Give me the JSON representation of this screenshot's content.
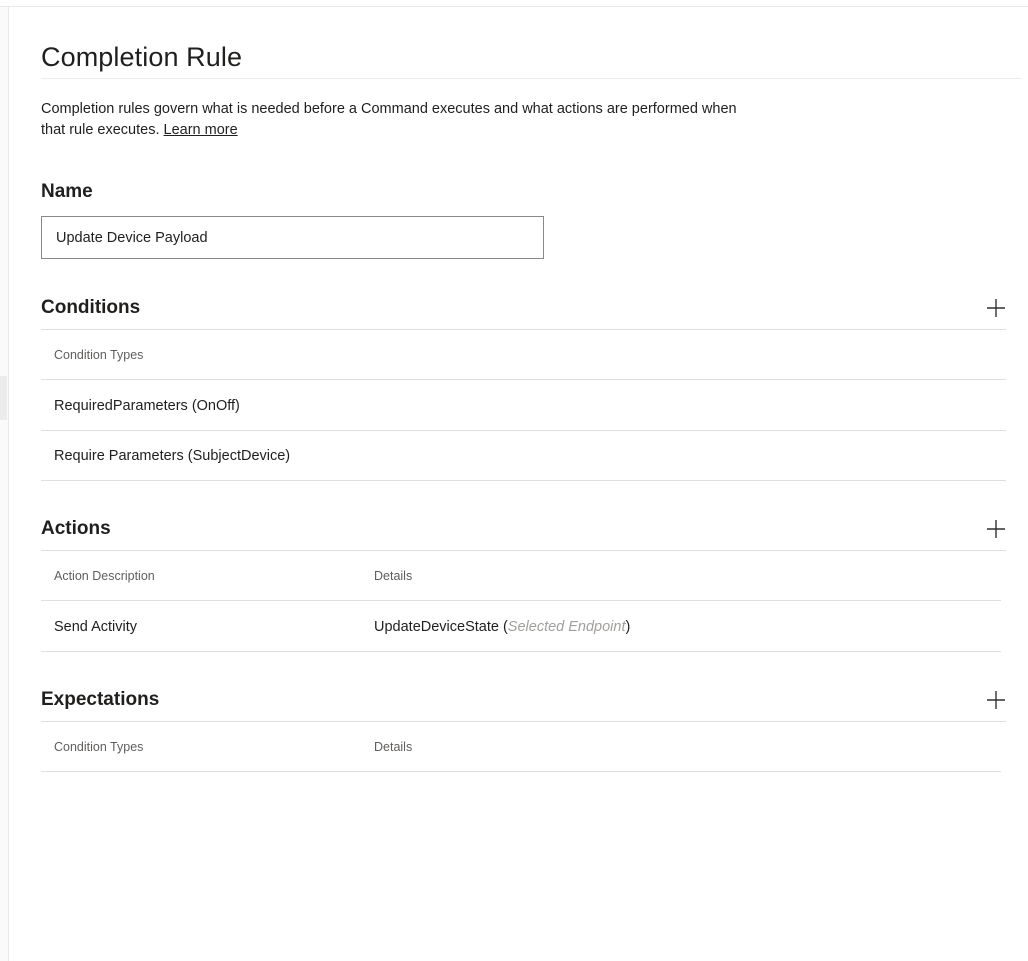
{
  "page": {
    "title": "Completion Rule",
    "description": "Completion rules govern what is needed before a Command executes and what actions are performed when that rule executes.",
    "learn_more": "Learn more"
  },
  "name_section": {
    "label": "Name",
    "value": "Update Device Payload"
  },
  "conditions": {
    "label": "Conditions",
    "add_icon": "plus-icon",
    "header": "Condition Types",
    "rows": [
      "RequiredParameters (OnOff)",
      "Require Parameters (SubjectDevice)"
    ]
  },
  "actions": {
    "label": "Actions",
    "add_icon": "plus-icon",
    "headers": {
      "description": "Action Description",
      "details": "Details"
    },
    "rows": [
      {
        "description": "Send Activity",
        "details_main": "UpdateDeviceState",
        "details_open": " (",
        "details_hint": "Selected Endpoint",
        "details_close": ")"
      }
    ]
  },
  "expectations": {
    "label": "Expectations",
    "add_icon": "plus-icon",
    "headers": {
      "type": "Condition Types",
      "details": "Details"
    }
  },
  "colors": {
    "text": "#201f1e",
    "muted": "#605e5c",
    "hint": "#a19f9d",
    "divider": "#e1dfdd"
  }
}
